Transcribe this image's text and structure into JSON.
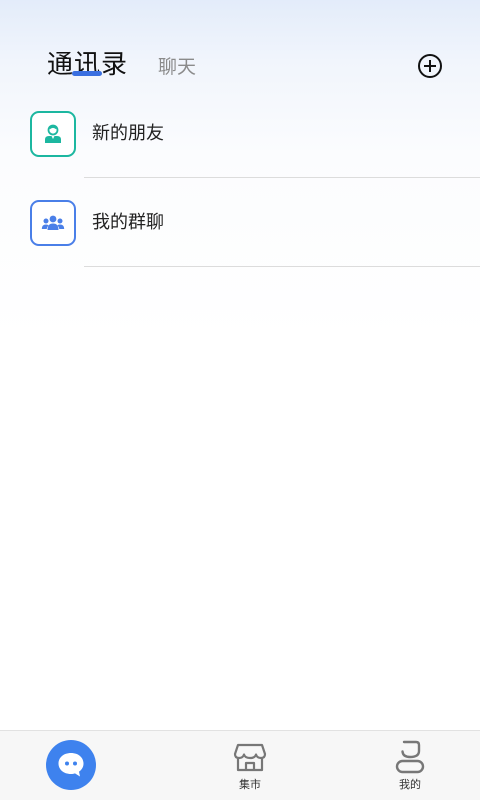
{
  "header": {
    "active_tab": "通讯录",
    "inactive_tab": "聊天",
    "add_icon": "plus-circle-icon"
  },
  "contacts": {
    "items": [
      {
        "label": "新的朋友",
        "icon": "new-friend-icon",
        "accent": "#1cb7a0"
      },
      {
        "label": "我的群聊",
        "icon": "group-chat-icon",
        "accent": "#4a7fe8"
      }
    ]
  },
  "bottom_nav": {
    "chat_icon": "chat-bubble-icon",
    "market_label": "集市",
    "market_icon": "store-icon",
    "mine_label": "我的",
    "mine_icon": "profile-icon",
    "active_color": "#3e82ee"
  }
}
